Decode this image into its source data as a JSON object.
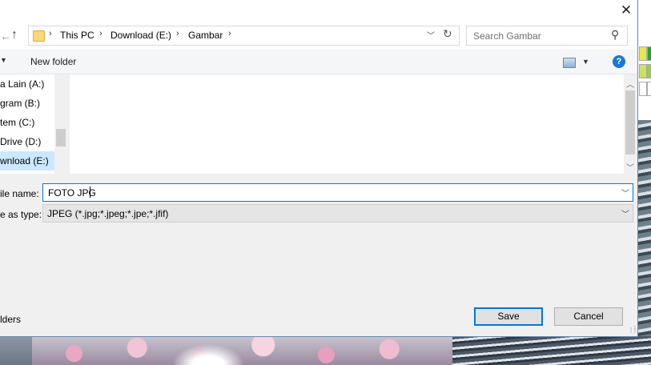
{
  "breadcrumb": [
    "This PC",
    "Download (E:)",
    "Gambar"
  ],
  "search": {
    "placeholder": "Search Gambar"
  },
  "toolbar": {
    "new_folder": "New folder"
  },
  "nav_items": [
    {
      "label": "a Lain (A:)"
    },
    {
      "label": "gram (B:)"
    },
    {
      "label": "tem (C:)"
    },
    {
      "label": "Drive (D:)"
    },
    {
      "label": "wnload (E:)",
      "selected": true
    }
  ],
  "file_name": {
    "label": "ile name:",
    "value": "FOTO JPG"
  },
  "save_as_type": {
    "label": "e as type:",
    "value": "JPEG (*.jpg;*.jpeg;*.jpe;*.jfif)"
  },
  "folders_link": "lders",
  "buttons": {
    "save": "Save",
    "cancel": "Cancel"
  },
  "icons": {
    "close": "close-icon",
    "back": "back-arrow-icon",
    "up": "up-arrow-icon",
    "folder": "folder-icon",
    "refresh": "refresh-icon",
    "search": "search-icon",
    "view": "view-options-icon",
    "help": "help-icon"
  },
  "colors": {
    "accent": "#0078d7",
    "selected_nav": "#cce8ff",
    "help": "#1a78d6"
  }
}
